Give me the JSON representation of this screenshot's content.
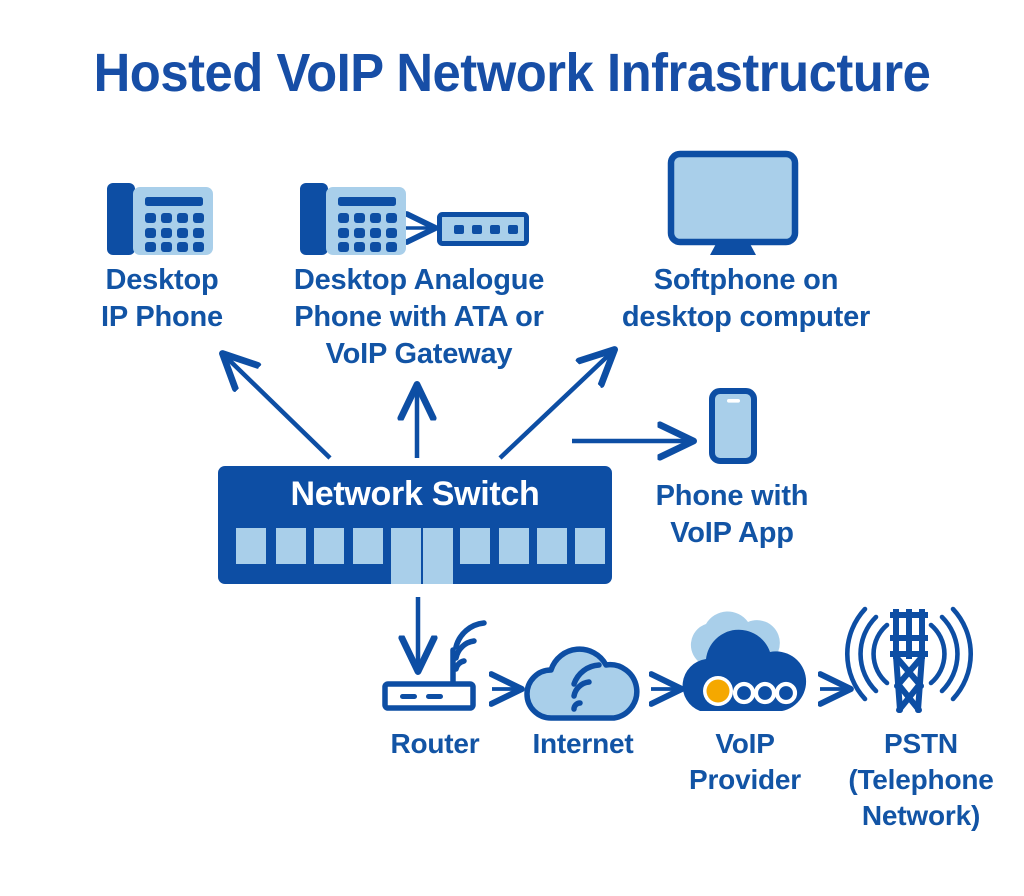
{
  "page": {
    "title": "Hosted VoIP Network Infrastructure",
    "background": "#ffffff"
  },
  "colors": {
    "dark_blue": "#0d4ea4",
    "title_blue": "#174ea6",
    "label_blue": "#1254a5",
    "light_blue": "#a9cfea",
    "accent_orange": "#f5a800",
    "white": "#ffffff"
  },
  "central_node": {
    "label": "Network Switch",
    "port_count": 10,
    "tall_port_indices": [
      4,
      5
    ]
  },
  "endpoints": [
    {
      "id": "desktop-ip-phone",
      "icon": "desk-phone-icon",
      "label": "Desktop\nIP Phone"
    },
    {
      "id": "desktop-analogue-phone",
      "icon": "desk-phone-with-ata-icon",
      "label": "Desktop Analogue\nPhone with ATA or\nVoIP Gateway"
    },
    {
      "id": "softphone",
      "icon": "desktop-monitor-icon",
      "label": "Softphone on\ndesktop computer"
    },
    {
      "id": "mobile-voip-app",
      "icon": "mobile-phone-icon",
      "label": "Phone with\nVoIP App"
    }
  ],
  "uplink_chain": [
    {
      "id": "router",
      "icon": "router-icon",
      "label": "Router"
    },
    {
      "id": "internet",
      "icon": "cloud-wifi-icon",
      "label": "Internet"
    },
    {
      "id": "voip-provider",
      "icon": "voip-cloud-icon",
      "label": "VoIP\nProvider"
    },
    {
      "id": "pstn",
      "icon": "radio-tower-icon",
      "label": "PSTN\n(Telephone\nNetwork)"
    }
  ],
  "connections": [
    {
      "from": "network-switch",
      "to": "desktop-ip-phone",
      "style": "arrow-diagonal-up-left"
    },
    {
      "from": "network-switch",
      "to": "desktop-analogue-phone",
      "style": "arrow-up"
    },
    {
      "from": "network-switch",
      "to": "softphone",
      "style": "arrow-diagonal-up-right"
    },
    {
      "from": "network-switch",
      "to": "mobile-voip-app",
      "style": "arrow-right"
    },
    {
      "from": "network-switch",
      "to": "router",
      "style": "arrow-down"
    },
    {
      "from": "desktop-analogue-phone-handset",
      "to": "ata-box",
      "style": "arrow-right-small"
    },
    {
      "from": "router",
      "to": "internet",
      "style": "arrow-right-small"
    },
    {
      "from": "internet",
      "to": "voip-provider",
      "style": "arrow-right-small"
    },
    {
      "from": "voip-provider",
      "to": "pstn",
      "style": "arrow-right-small"
    }
  ]
}
